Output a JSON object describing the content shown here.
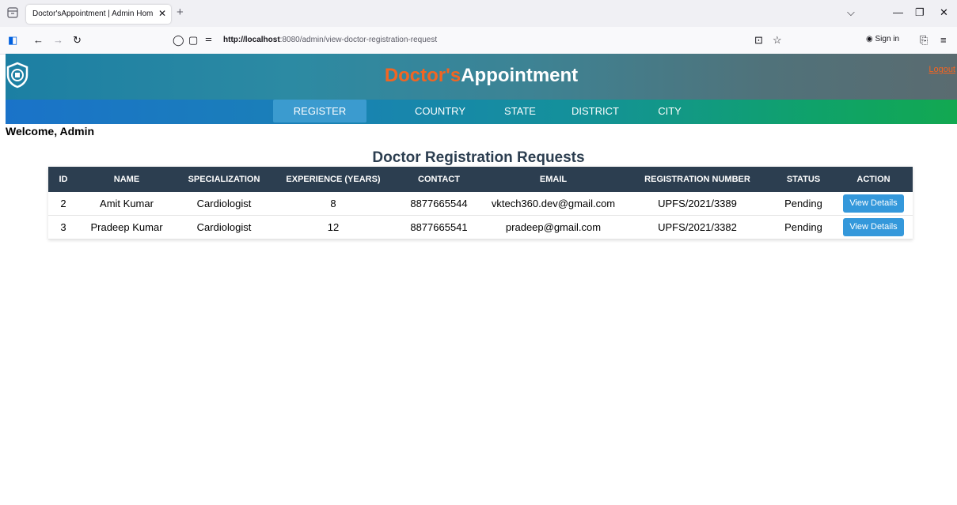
{
  "browser": {
    "tab_title": "Doctor'sAppointment | Admin Hom",
    "url_host": "http://localhost",
    "url_rest": ":8080/admin/view-doctor-registration-request",
    "sign_in": "Sign in"
  },
  "header": {
    "brand_part1": "Doctor's",
    "brand_part2": "Appointment",
    "logout": "Logout"
  },
  "menu": {
    "items": [
      {
        "label": "REGISTER DOCTOR"
      },
      {
        "label": "COUNTRY"
      },
      {
        "label": "STATE"
      },
      {
        "label": "DISTRICT"
      },
      {
        "label": "CITY"
      }
    ]
  },
  "welcome": "Welcome, Admin",
  "page_title": "Doctor Registration Requests",
  "table": {
    "headers": [
      "ID",
      "NAME",
      "SPECIALIZATION",
      "EXPERIENCE (YEARS)",
      "CONTACT",
      "EMAIL",
      "REGISTRATION NUMBER",
      "STATUS",
      "ACTION"
    ],
    "rows": [
      {
        "id": "2",
        "name": "Amit Kumar",
        "specialization": "Cardiologist",
        "experience": "8",
        "contact": "8877665544",
        "email": "vktech360.dev@gmail.com",
        "reg_no": "UPFS/2021/3389",
        "status": "Pending",
        "action": "View Details"
      },
      {
        "id": "3",
        "name": "Pradeep Kumar",
        "specialization": "Cardiologist",
        "experience": "12",
        "contact": "8877665541",
        "email": "pradeep@gmail.com",
        "reg_no": "UPFS/2021/3382",
        "status": "Pending",
        "action": "View Details"
      }
    ]
  },
  "colors": {
    "brand_accent": "#f26522",
    "table_header": "#2c3e50",
    "button": "#3498db"
  }
}
